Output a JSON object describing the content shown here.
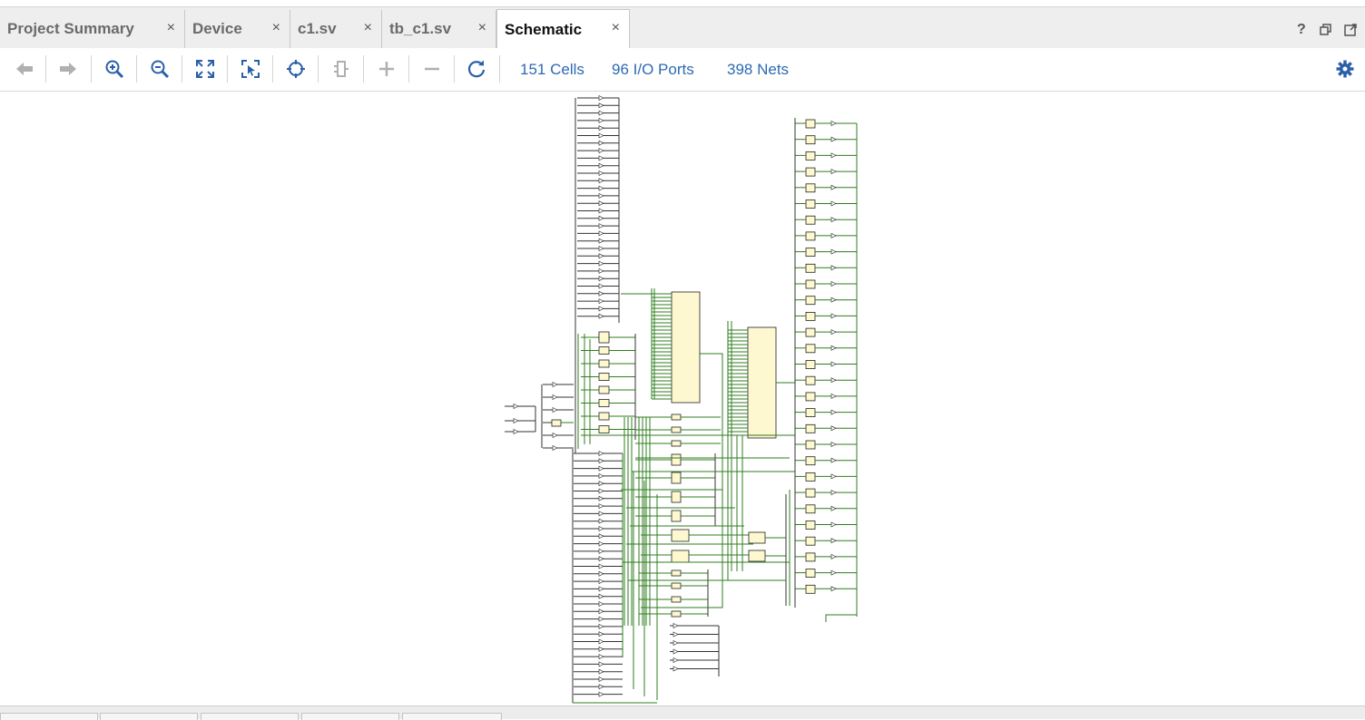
{
  "tabs": [
    {
      "label": "Project Summary",
      "active": false
    },
    {
      "label": "Device",
      "active": false
    },
    {
      "label": "c1.sv",
      "active": false
    },
    {
      "label": "tb_c1.sv",
      "active": false
    },
    {
      "label": "Schematic",
      "active": true
    }
  ],
  "tab_close_glyph": "×",
  "window_controls": [
    "help-icon",
    "restore-icon",
    "maximize-icon"
  ],
  "toolbar": {
    "icons": [
      "back-icon",
      "forward-icon",
      "zoom-in-icon",
      "zoom-out-icon",
      "zoom-fit-icon",
      "zoom-select-icon",
      "autofit-selection-icon",
      "collapse-cell-icon",
      "expand-icon",
      "collapse-icon",
      "regenerate-icon"
    ],
    "stats": {
      "cells": "151 Cells",
      "ports": "96 I/O Ports",
      "nets": "398 Nets"
    },
    "settings_icon": "gear-icon"
  },
  "colors": {
    "wire": "#2f7d1e",
    "cell_fill": "#fdf8cf",
    "link": "#2d6ab4",
    "icon": "#2b5fa8",
    "icon_disabled": "#b0b0b0"
  }
}
